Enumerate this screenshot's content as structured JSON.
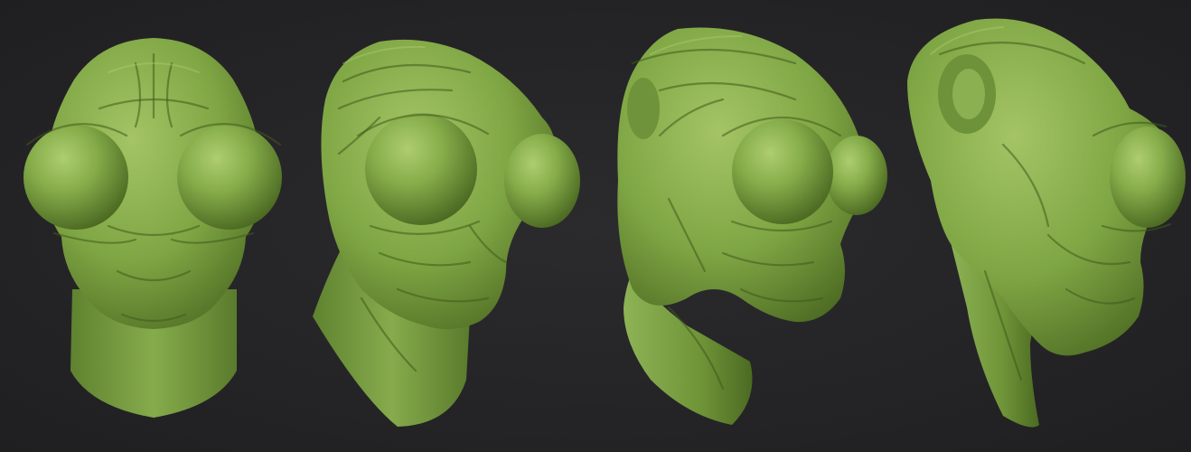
{
  "scene": {
    "background_color": "#262628",
    "skin_color": "#7fa644",
    "skin_shadow_color": "#4c6a22",
    "skin_highlight_color": "#a9c96b"
  },
  "views": [
    {
      "name": "front-view"
    },
    {
      "name": "three-quarter-view"
    },
    {
      "name": "angled-side-view"
    },
    {
      "name": "side-view"
    }
  ]
}
